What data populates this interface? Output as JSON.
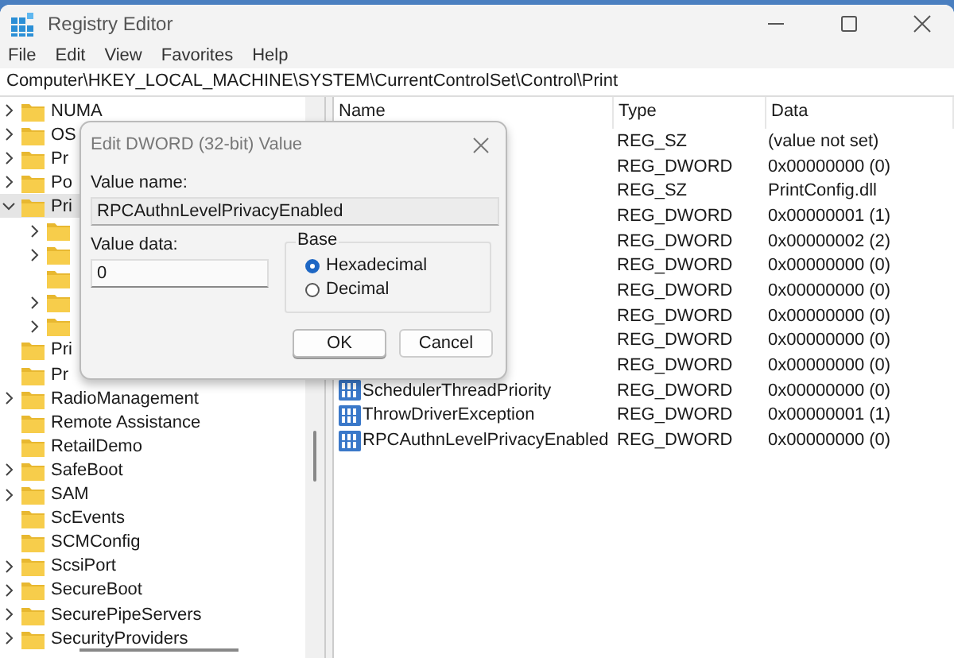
{
  "window": {
    "title": "Registry Editor"
  },
  "menu": [
    "File",
    "Edit",
    "View",
    "Favorites",
    "Help"
  ],
  "address": "Computer\\HKEY_LOCAL_MACHINE\\SYSTEM\\CurrentControlSet\\Control\\Print",
  "tree": {
    "items": [
      {
        "label": "NUMA",
        "has_children": true,
        "expanded": false,
        "selected": false
      },
      {
        "label": "OS",
        "has_children": true,
        "expanded": false,
        "selected": false
      },
      {
        "label": "Pr",
        "has_children": true,
        "expanded": false,
        "selected": false
      },
      {
        "label": "Po",
        "has_children": true,
        "expanded": false,
        "selected": false
      },
      {
        "label": "Pri",
        "has_children": true,
        "expanded": true,
        "selected": true,
        "children": [
          {
            "has_children": true,
            "expanded": false,
            "selected": false
          },
          {
            "has_children": true,
            "expanded": false,
            "selected": false
          },
          {
            "has_children": false,
            "expanded": false,
            "selected": false
          },
          {
            "has_children": true,
            "expanded": false,
            "selected": false
          },
          {
            "has_children": true,
            "expanded": false,
            "selected": false
          }
        ]
      },
      {
        "label": "Pri",
        "has_children": false,
        "expanded": false,
        "selected": false
      },
      {
        "label": "Pr",
        "has_children": false,
        "expanded": false,
        "selected": false
      },
      {
        "label": "RadioManagement",
        "has_children": true,
        "expanded": false,
        "selected": false
      },
      {
        "label": "Remote Assistance",
        "has_children": false,
        "expanded": false,
        "selected": false
      },
      {
        "label": "RetailDemo",
        "has_children": false,
        "expanded": false,
        "selected": false
      },
      {
        "label": "SafeBoot",
        "has_children": true,
        "expanded": false,
        "selected": false
      },
      {
        "label": "SAM",
        "has_children": true,
        "expanded": false,
        "selected": false
      },
      {
        "label": "ScEvents",
        "has_children": false,
        "expanded": false,
        "selected": false
      },
      {
        "label": "SCMConfig",
        "has_children": false,
        "expanded": false,
        "selected": false
      },
      {
        "label": "ScsiPort",
        "has_children": true,
        "expanded": false,
        "selected": false
      },
      {
        "label": "SecureBoot",
        "has_children": true,
        "expanded": false,
        "selected": false
      },
      {
        "label": "SecurePipeServers",
        "has_children": true,
        "expanded": false,
        "selected": false
      },
      {
        "label": "SecurityProviders",
        "has_children": true,
        "expanded": false,
        "selected": false
      }
    ]
  },
  "list": {
    "columns": [
      "Name",
      "Type",
      "Data"
    ],
    "rows": [
      {
        "type": "REG_SZ",
        "data": "(value not set)"
      },
      {
        "type": "REG_DWORD",
        "data": "0x00000000 (0)"
      },
      {
        "type": "REG_SZ",
        "data": "PrintConfig.dll"
      },
      {
        "type": "REG_DWORD",
        "data": "0x00000001 (1)"
      },
      {
        "type": "REG_DWORD",
        "data": "0x00000002 (2)"
      },
      {
        "type": "REG_DWORD",
        "data": "0x00000000 (0)"
      },
      {
        "type": "REG_DWORD",
        "data": "0x00000000 (0)"
      },
      {
        "type": "REG_DWORD",
        "data": "0x00000000 (0)"
      },
      {
        "type": "REG_DWORD",
        "data": "0x00000000 (0)"
      },
      {
        "type": "REG_DWORD",
        "data": "0x00000000 (0)"
      },
      {
        "name": "SchedulerThreadPriority",
        "type": "REG_DWORD",
        "data": "0x00000000 (0)"
      },
      {
        "name": "ThrowDriverException",
        "type": "REG_DWORD",
        "data": "0x00000001 (1)"
      },
      {
        "name": "RPCAuthnLevelPrivacyEnabled",
        "type": "REG_DWORD",
        "data": "0x00000000 (0)"
      }
    ]
  },
  "dialog": {
    "title": "Edit DWORD (32-bit) Value",
    "value_name_label": "Value name:",
    "value_name": "RPCAuthnLevelPrivacyEnabled",
    "value_data_label": "Value data:",
    "value_data": "0",
    "base_label": "Base",
    "options": [
      {
        "label": "Hexadecimal",
        "selected": true
      },
      {
        "label": "Decimal",
        "selected": false
      }
    ],
    "buttons": [
      {
        "label": "OK",
        "default": true
      },
      {
        "label": "Cancel",
        "default": false
      }
    ]
  }
}
